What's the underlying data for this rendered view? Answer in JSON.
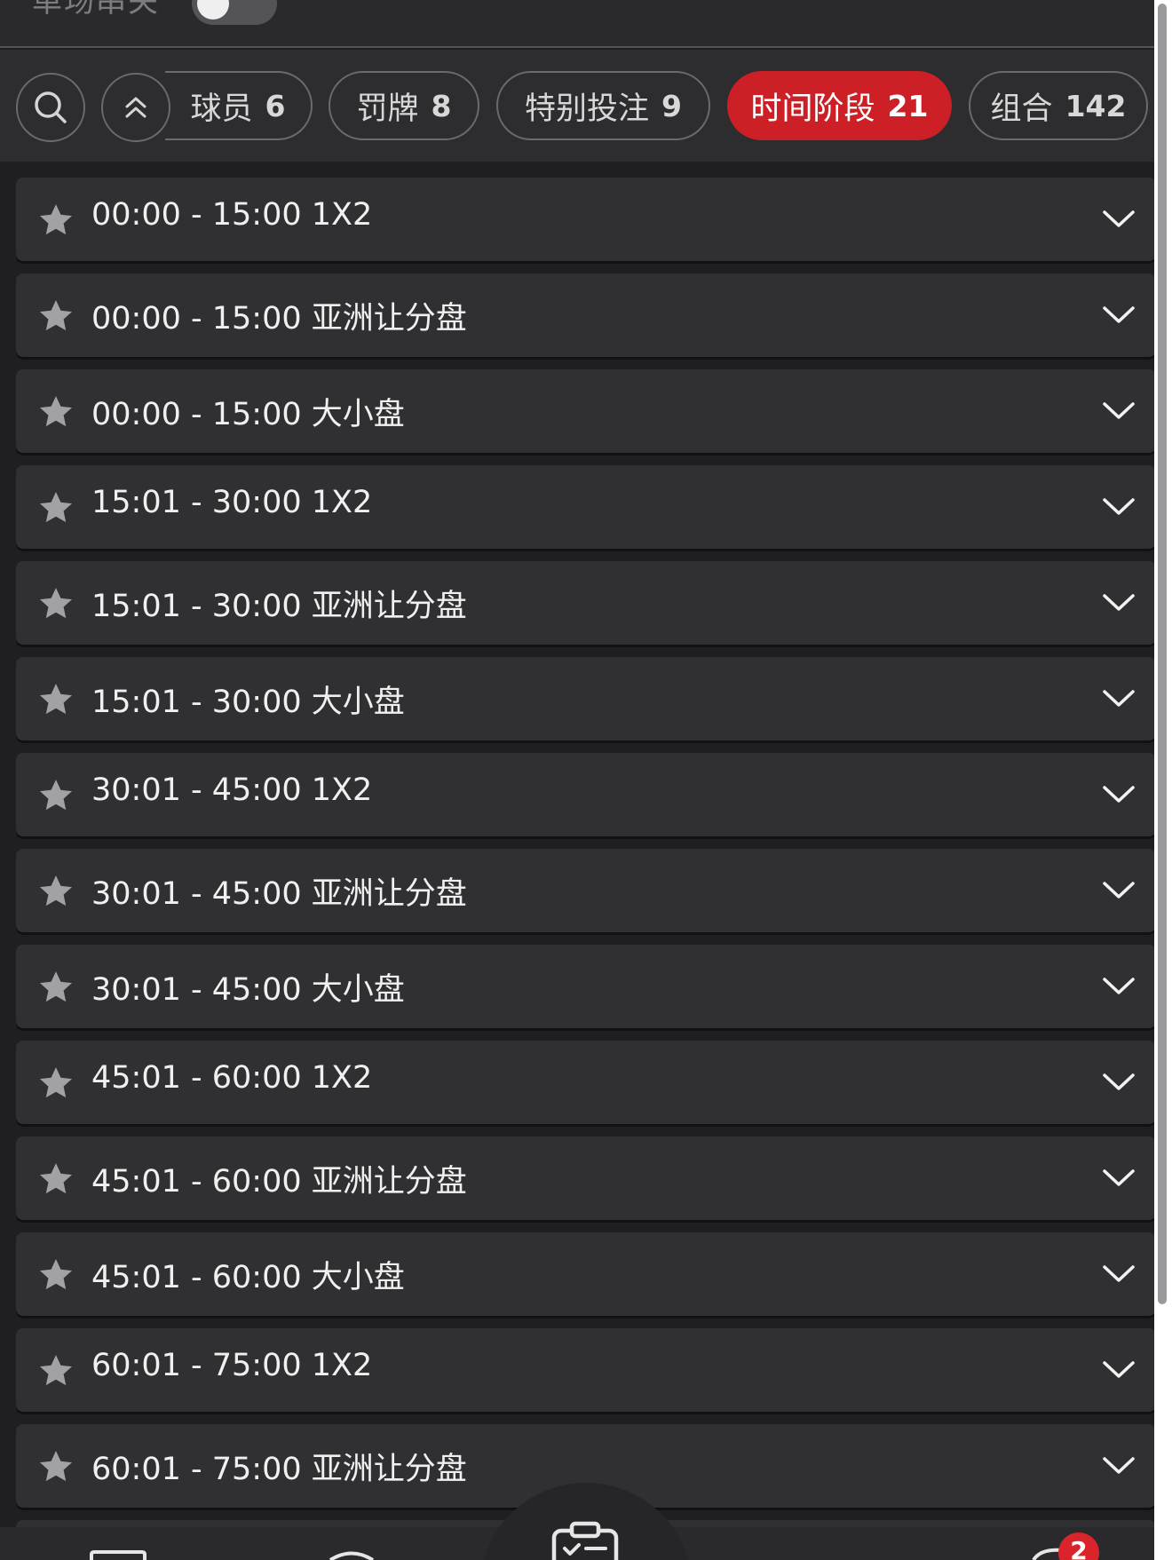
{
  "header": {
    "single_match_label": "单场串关",
    "single_match_toggle_on": false
  },
  "filters": {
    "tabs": [
      {
        "label": "球员",
        "count": "6",
        "active": false
      },
      {
        "label": "罚牌",
        "count": "8",
        "active": false
      },
      {
        "label": "特别投注",
        "count": "9",
        "active": false
      },
      {
        "label": "时间阶段",
        "count": "21",
        "active": true
      },
      {
        "label": "组合",
        "count": "142",
        "active": false
      }
    ],
    "icons": [
      "search-icon",
      "double-chevron-up-icon"
    ]
  },
  "markets": [
    {
      "title": "00:00 - 15:00 1X2"
    },
    {
      "title": "00:00 - 15:00 亚洲让分盘"
    },
    {
      "title": "00:00 - 15:00 大小盘"
    },
    {
      "title": "15:01 - 30:00 1X2"
    },
    {
      "title": "15:01 - 30:00 亚洲让分盘"
    },
    {
      "title": "15:01 - 30:00 大小盘"
    },
    {
      "title": "30:01 - 45:00 1X2"
    },
    {
      "title": "30:01 - 45:00 亚洲让分盘"
    },
    {
      "title": "30:01 - 45:00 大小盘"
    },
    {
      "title": "45:01 - 60:00 1X2"
    },
    {
      "title": "45:01 - 60:00 亚洲让分盘"
    },
    {
      "title": "45:01 - 60:00 大小盘"
    },
    {
      "title": "60:01 - 75:00 1X2"
    },
    {
      "title": "60:01 - 75:00 亚洲让分盘"
    }
  ],
  "bottom_nav": {
    "bet_slip_badge": "2"
  },
  "colors": {
    "accent": "#cc1f26",
    "row_background": "#303032",
    "page_background": "#1f1f21"
  }
}
